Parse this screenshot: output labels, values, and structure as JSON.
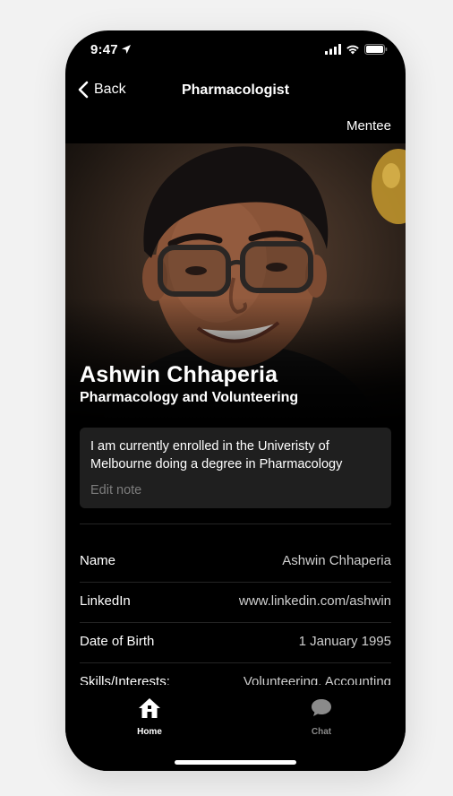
{
  "status": {
    "time": "9:47"
  },
  "nav": {
    "back_label": "Back",
    "title": "Pharmacologist"
  },
  "role_tag": "Mentee",
  "profile": {
    "name": "Ashwin Chhaperia",
    "subtitle": "Pharmacology and Volunteering"
  },
  "note": {
    "text": "I am currently enrolled in the Univeristy of Melbourne doing a degree in Pharmacology",
    "edit_label": "Edit note"
  },
  "details": [
    {
      "label": "Name",
      "value": "Ashwin Chhaperia"
    },
    {
      "label": "LinkedIn",
      "value": "www.linkedin.com/ashwin"
    },
    {
      "label": "Date of Birth",
      "value": "1 January 1995"
    },
    {
      "label": "Skills/Interests:",
      "value": "Volunteering, Accounting"
    }
  ],
  "tabs": [
    {
      "label": "Home",
      "icon": "home-icon",
      "active": true
    },
    {
      "label": "Chat",
      "icon": "chat-icon",
      "active": false
    }
  ],
  "colors": {
    "background": "#000000",
    "card": "#1f1f1f",
    "text": "#ffffff",
    "muted": "#7d7d7d",
    "inactive_tab": "#8a8a8a"
  }
}
